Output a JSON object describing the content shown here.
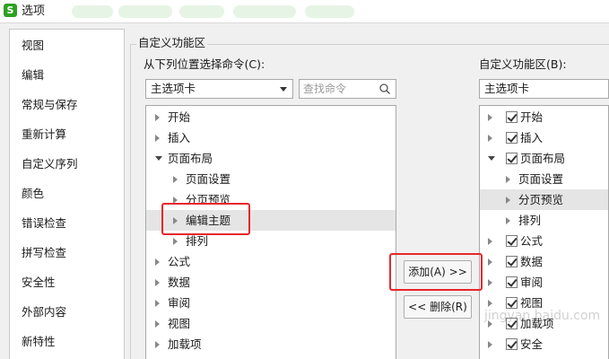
{
  "window": {
    "title": "选项",
    "app_icon_letter": "S"
  },
  "nav": {
    "items": [
      "视图",
      "编辑",
      "常规与保存",
      "重新计算",
      "自定义序列",
      "颜色",
      "错误检查",
      "拼写检查",
      "安全性",
      "外部内容",
      "新特性"
    ]
  },
  "group": {
    "title": "自定义功能区"
  },
  "left_panel": {
    "label": "从下列位置选择命令(C):",
    "select_value": "主选项卡",
    "search_placeholder": "查找命令",
    "items": [
      "开始",
      "插入",
      "页面布局",
      "页面设置",
      "分页预览",
      "编辑主题",
      "排列",
      "公式",
      "数据",
      "审阅",
      "视图",
      "加载项"
    ]
  },
  "right_panel": {
    "label": "自定义功能区(B):",
    "select_value": "主选项卡",
    "items": [
      "开始",
      "插入",
      "页面布局",
      "页面设置",
      "分页预览",
      "排列",
      "公式",
      "数据",
      "审阅",
      "视图",
      "加载项",
      "安全"
    ]
  },
  "buttons": {
    "add": "添加(A) >>",
    "remove": "<< 删除(R)"
  },
  "watermark": "jingyan.baidu.com",
  "colors": {
    "highlight_box": "#e8262a",
    "app_icon": "#2ea121"
  }
}
